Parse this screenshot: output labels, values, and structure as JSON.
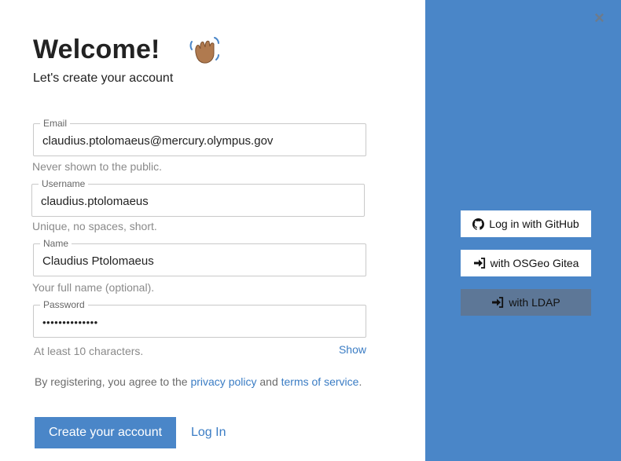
{
  "header": {
    "title": "Welcome!",
    "subtitle": "Let's create your account"
  },
  "form": {
    "email": {
      "legend": "Email",
      "value": "claudius.ptolomaeus@mercury.olympus.gov",
      "hint": "Never shown to the public."
    },
    "username": {
      "legend": "Username",
      "value": "claudius.ptolomaeus",
      "hint": "Unique, no spaces, short."
    },
    "name": {
      "legend": "Name",
      "value": "Claudius Ptolomaeus",
      "hint": "Your full name (optional)."
    },
    "password": {
      "legend": "Password",
      "value": "••••••••••••••",
      "hint": "At least 10 characters.",
      "show_label": "Show"
    }
  },
  "agreement": {
    "prefix": "By registering, you agree to the ",
    "privacy_label": "privacy policy",
    "middle": " and ",
    "terms_label": "terms of service",
    "suffix": "."
  },
  "actions": {
    "create_label": "Create your account",
    "login_label": "Log In"
  },
  "sidebar": {
    "close_label": "×",
    "providers": [
      {
        "label": "Log in with GitHub",
        "icon": "github-icon"
      },
      {
        "label": "with OSGeo Gitea",
        "icon": "sign-in-icon"
      },
      {
        "label": "with LDAP",
        "icon": "sign-in-icon"
      }
    ]
  },
  "colors": {
    "accent": "#4a86c8",
    "link": "#3a7cc4",
    "ldap_button": "#5d7797"
  }
}
